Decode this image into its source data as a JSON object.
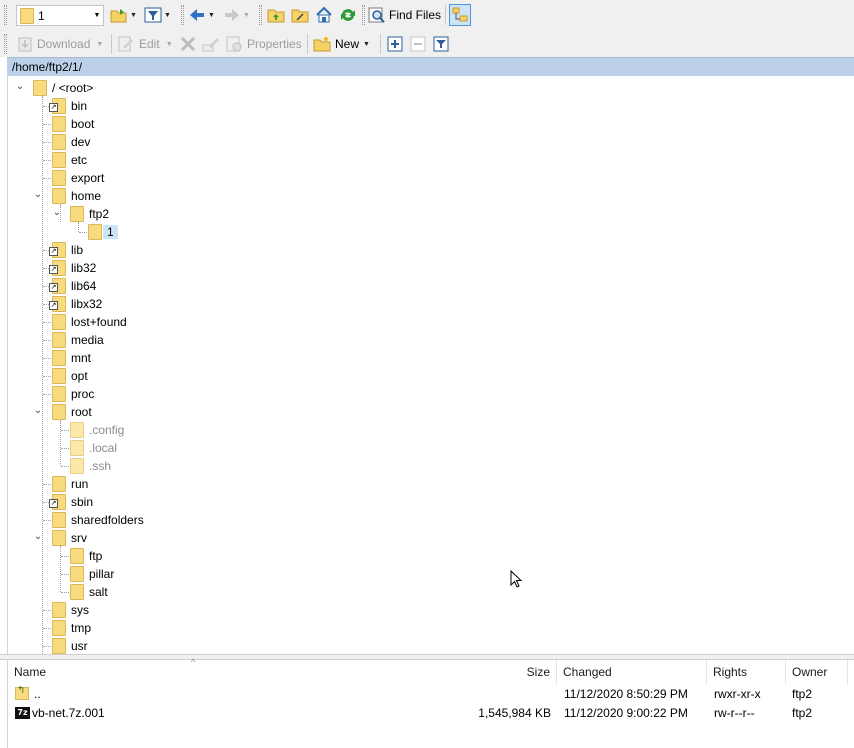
{
  "toolbar1": {
    "location_value": "1",
    "find_files_label": "Find Files"
  },
  "toolbar2": {
    "download_label": "Download",
    "edit_label": "Edit",
    "properties_label": "Properties",
    "new_label": "New"
  },
  "path": "/home/ftp2/1/",
  "tree": {
    "root_label": "/ <root>",
    "items": [
      {
        "label": "bin"
      },
      {
        "label": "boot"
      },
      {
        "label": "dev"
      },
      {
        "label": "etc"
      },
      {
        "label": "export"
      },
      {
        "label": "home"
      },
      {
        "label": "ftp2"
      },
      {
        "label": "1"
      },
      {
        "label": "lib"
      },
      {
        "label": "lib32"
      },
      {
        "label": "lib64"
      },
      {
        "label": "libx32"
      },
      {
        "label": "lost+found"
      },
      {
        "label": "media"
      },
      {
        "label": "mnt"
      },
      {
        "label": "opt"
      },
      {
        "label": "proc"
      },
      {
        "label": "root"
      },
      {
        "label": ".config"
      },
      {
        "label": ".local"
      },
      {
        "label": ".ssh"
      },
      {
        "label": "run"
      },
      {
        "label": "sbin"
      },
      {
        "label": "sharedfolders"
      },
      {
        "label": "srv"
      },
      {
        "label": "ftp"
      },
      {
        "label": "pillar"
      },
      {
        "label": "salt"
      },
      {
        "label": "sys"
      },
      {
        "label": "tmp"
      },
      {
        "label": "usr"
      }
    ]
  },
  "filelist": {
    "columns": {
      "name": "Name",
      "size": "Size",
      "changed": "Changed",
      "rights": "Rights",
      "owner": "Owner"
    },
    "rows": [
      {
        "name": "..",
        "size": "",
        "changed": "11/12/2020 8:50:29 PM",
        "rights": "rwxr-xr-x",
        "owner": "ftp2"
      },
      {
        "name": "vb-net.7z.001",
        "size": "1,545,984 KB",
        "changed": "11/12/2020 9:00:22 PM",
        "rights": "rw-r--r--",
        "owner": "ftp2"
      }
    ]
  },
  "icons": {
    "folder": "folder-icon",
    "symlink": "symlink-overlay-icon",
    "archive": "7z-archive-icon",
    "parent": "parent-directory-icon"
  },
  "colors": {
    "path_bar": "#bcd0ea",
    "selection": "#cce4f7",
    "folder": "#f9db7f"
  }
}
